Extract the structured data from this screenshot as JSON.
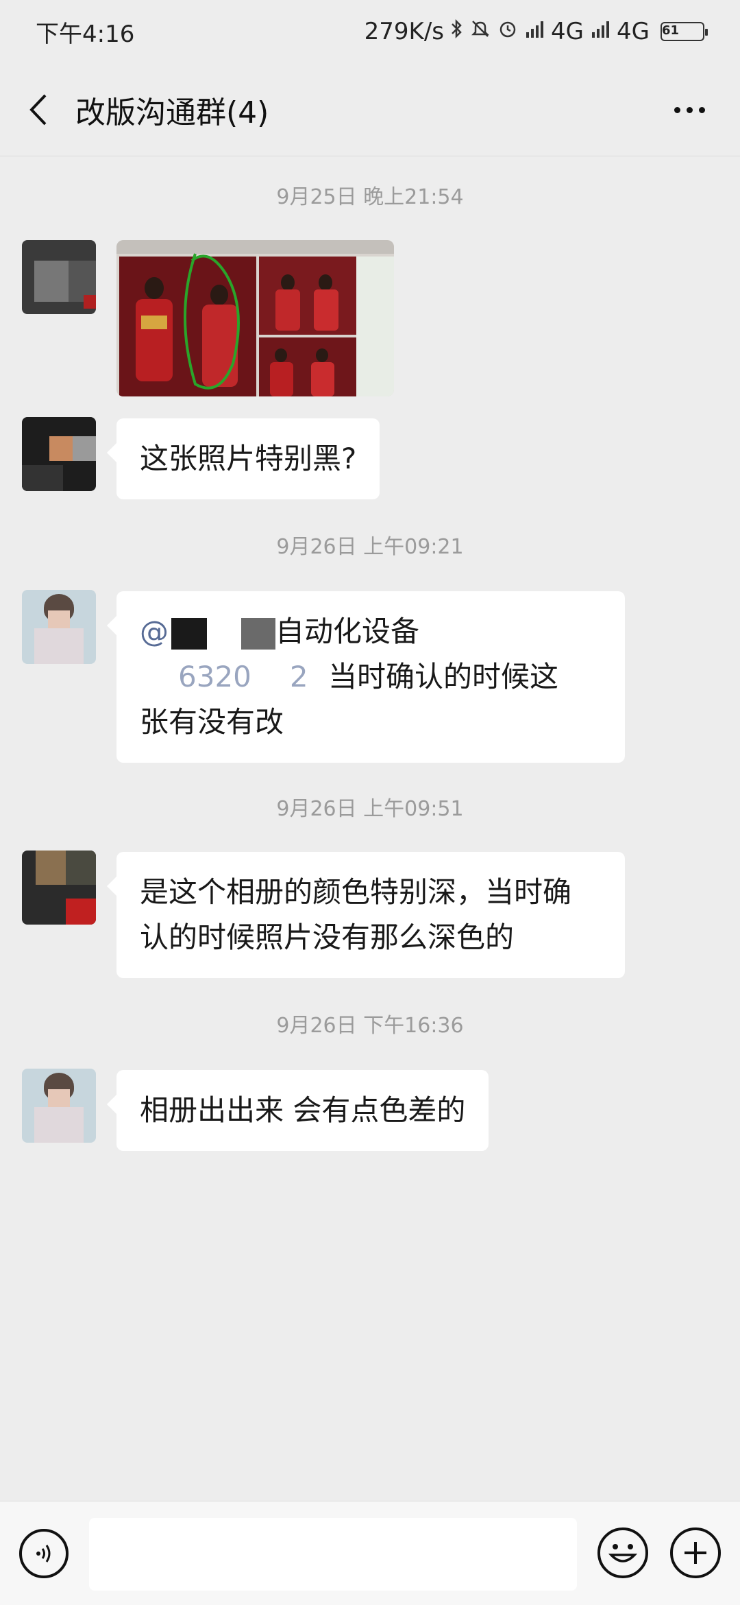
{
  "status_bar": {
    "time": "下午4:16",
    "net_speed": "279K/s",
    "signal1": "4G",
    "signal2": "4G",
    "battery": "61"
  },
  "header": {
    "title": "改版沟通群(4)"
  },
  "messages": [
    {
      "timestamp": "9月25日 晚上21:54",
      "type": "image",
      "image_desc": "wedding-album-photo"
    },
    {
      "type": "text",
      "text": "这张照片特别黑?"
    },
    {
      "timestamp": "9月26日 上午09:21",
      "type": "text",
      "mention": "@",
      "mention_suffix": "自动化设备",
      "number_fragment": "6320",
      "number_fragment2": "2",
      "line2_rest": "当时确认的时候这",
      "line3": "张有没有改"
    },
    {
      "timestamp": "9月26日 上午09:51",
      "type": "text",
      "line1": "是这个相册的颜色特别深，当时确",
      "line2": "认的时候照片没有那么深色的"
    },
    {
      "timestamp": "9月26日 下午16:36",
      "type": "text",
      "text": "相册出出来 会有点色差的"
    }
  ],
  "input_bar": {
    "placeholder": ""
  },
  "colors": {
    "background": "#ededed",
    "bubble": "#ffffff",
    "mention": "#576b95",
    "timestamp": "#9b9b9b"
  }
}
